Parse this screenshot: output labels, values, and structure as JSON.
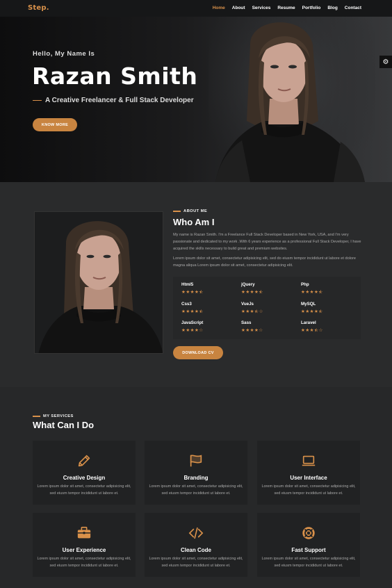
{
  "nav": {
    "logo": "Step.",
    "items": [
      "Home",
      "About",
      "Services",
      "Resume",
      "Portfolio",
      "Blog",
      "Contact"
    ],
    "active": "Home"
  },
  "hero": {
    "greeting": "Hello, My Name Is",
    "name": "Razan Smith",
    "subtitle": "A Creative Freelancer & Full Stack Developer",
    "button": "KNOW MORE"
  },
  "settings_icon": "gear-icon",
  "about": {
    "eyebrow": "ABOUT ME",
    "title": "Who Am I",
    "paragraph1": "My name is Razan Smith. I'm a Freelance Full Stack Developer based in New York, USA, and I'm very passionate and dedicated to my work .With 6 years experience as a professional Full Stack Developer, I have acquired the skills necessary to build great and premium websites.",
    "paragraph2": "Lorem ipsum dolor sit amet, consectetur adipisicing elit, sed do eiusm tempor incididunt ut labore et dolore magna aliqua Lorem ipsum dolor sit amet, consectetur adipisicing elit.",
    "skills": [
      {
        "name": "Html5",
        "rating": 4.5
      },
      {
        "name": "jQuery",
        "rating": 4.5
      },
      {
        "name": "Php",
        "rating": 4.5
      },
      {
        "name": "Css3",
        "rating": 4.5
      },
      {
        "name": "VueJs",
        "rating": 3.5
      },
      {
        "name": "MySQL",
        "rating": 4.5
      },
      {
        "name": "JavaScript",
        "rating": 4
      },
      {
        "name": "Sass",
        "rating": 4
      },
      {
        "name": "Laravel",
        "rating": 3.5
      }
    ],
    "button": "DOWNLOAD CV"
  },
  "services": {
    "eyebrow": "MY SERVICES",
    "title": "What Can I Do",
    "items": [
      {
        "title": "Creative Design",
        "icon": "pencil-icon",
        "text": "Lorem ipsum dolor sit amet, consectetur adipisicing elit, sed eiusm tempor incididunt ut labore et."
      },
      {
        "title": "Branding",
        "icon": "flag-icon",
        "text": "Lorem ipsum dolor sit amet, consectetur adipisicing elit, sed eiusm tempor incididunt ut labore et."
      },
      {
        "title": "User Interface",
        "icon": "laptop-icon",
        "text": "Lorem ipsum dolor sit amet, consectetur adipisicing elit, sed eiusm tempor incididunt ut labore et."
      },
      {
        "title": "User Experience",
        "icon": "briefcase-icon",
        "text": "Lorem ipsum dolor sit amet, consectetur adipisicing elit, sed eiusm tempor incididunt ut labore et."
      },
      {
        "title": "Clean Code",
        "icon": "code-icon",
        "text": "Lorem ipsum dolor sit amet, consectetur adipisicing elit, sed eiusm tempor incididunt ut labore et."
      },
      {
        "title": "Fast Support",
        "icon": "lifebuoy-icon",
        "text": "Lorem ipsum dolor sit amet, consectetur adipisicing elit, sed eiusm tempor incididunt ut labore et."
      }
    ]
  },
  "colors": {
    "accent": "#d9914a",
    "button": "#c88440",
    "background": "#2a2b2c",
    "card": "#212223"
  }
}
